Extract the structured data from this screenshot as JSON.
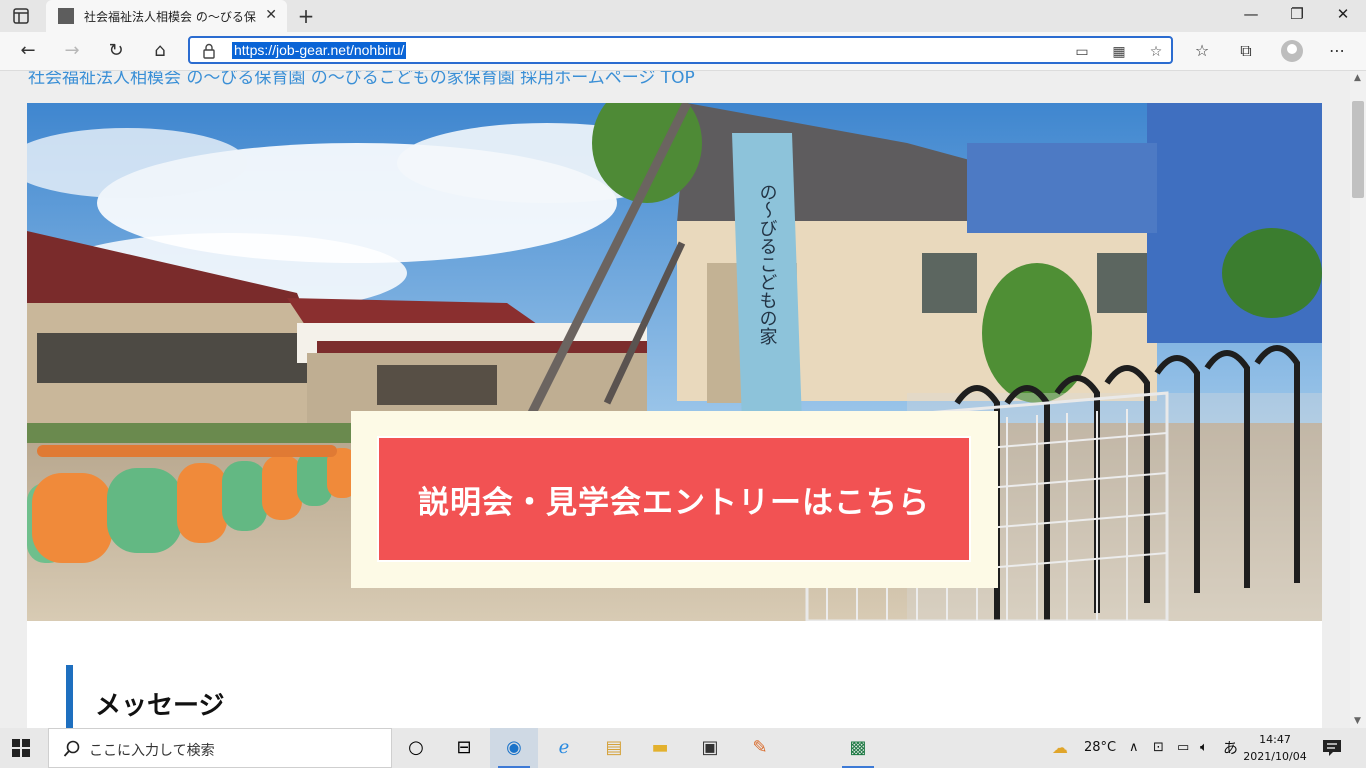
{
  "browser": {
    "tab_title": "社会福祉法人相模会 の〜びる保育",
    "tab_close": "✕",
    "new_tab": "+",
    "url": "https://job-gear.net/nohbiru/",
    "window_controls": {
      "minimize": "—",
      "maximize": "❐",
      "close": "✕"
    },
    "nav_icons": [
      "back-icon",
      "forward-icon",
      "refresh-icon",
      "home-icon"
    ],
    "url_icons": [
      "lock-icon",
      "read-aloud-icon",
      "apps-icon",
      "add-favorite-icon"
    ],
    "toolbar_icons": [
      "favorites-icon",
      "collections-icon",
      "profile-icon",
      "more-icon"
    ]
  },
  "page": {
    "top_link": "社会福祉法人相模会 の〜びる保育園 の〜びるこどもの家保育園 採用ホームページ TOP",
    "cta_label": "説明会・見学会エントリーはこちら",
    "section_title": "メッセージ",
    "sign_text": "の〜びるこどもの家",
    "colors": {
      "cta": "#f25253",
      "cta_frame": "#fdfae6",
      "accent_bar": "#1e6fbf",
      "link": "#3a8fd6"
    }
  },
  "taskbar": {
    "search_placeholder": "ここに入力して検索",
    "weather": "28°C",
    "ime": "あ",
    "time": "14:47",
    "date": "2021/10/04",
    "apps": [
      "cortana-icon",
      "task-view-icon",
      "edge-icon",
      "ie-icon",
      "explorer-icon",
      "folder-icon",
      "store-icon",
      "paint-icon",
      "excel-icon"
    ]
  }
}
